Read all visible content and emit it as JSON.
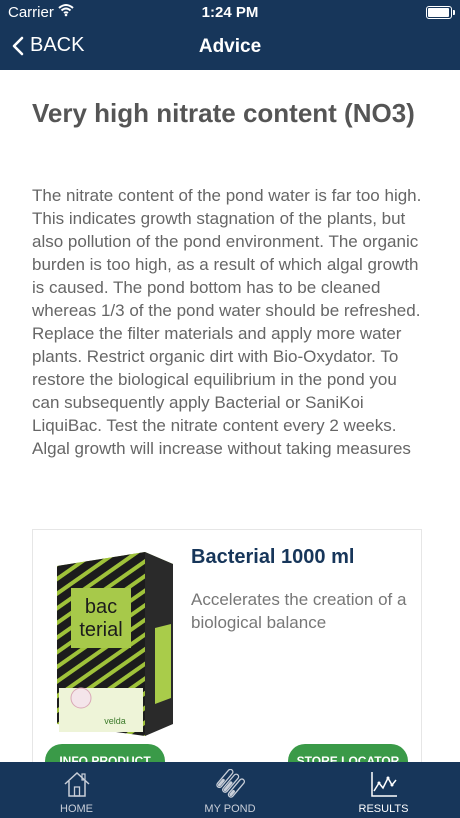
{
  "status_bar": {
    "carrier": "Carrier",
    "time": "1:24 PM"
  },
  "nav": {
    "back_label": "BACK",
    "title": "Advice"
  },
  "advice": {
    "heading": "Very high nitrate content (NO3)",
    "body": "The nitrate content of the pond water is far too high. This indicates growth stagnation of the plants, but also pollution of the pond environment. The organic burden is too high, as a result of which algal growth is caused. The pond bottom has to be cleaned whereas 1/3 of the pond water should be refreshed. Replace the filter materials and apply more water plants. Restrict organic dirt with Bio-Oxydator. To restore the biological equilibrium in the pond you can subsequently apply Bacterial or SaniKoi LiquiBac. Test the nitrate content every 2 weeks. Algal growth will increase without taking measures"
  },
  "product": {
    "title": "Bacterial 1000 ml",
    "description": "Accelerates the creation of a biological balance",
    "box_text": {
      "brand_line1": "bac",
      "brand_line2": "terial",
      "maker": "velda"
    },
    "info_button": "INFO PRODUCT",
    "store_button": "STORE LOCATOR"
  },
  "tabs": [
    {
      "label": "HOME",
      "icon": "home-icon",
      "active": false
    },
    {
      "label": "MY POND",
      "icon": "test-tubes-icon",
      "active": false
    },
    {
      "label": "RESULTS",
      "icon": "chart-icon",
      "active": true
    }
  ],
  "colors": {
    "navy": "#17365a",
    "green_button": "#3a9a48",
    "heading_gray": "#555555",
    "body_gray": "#666666"
  }
}
